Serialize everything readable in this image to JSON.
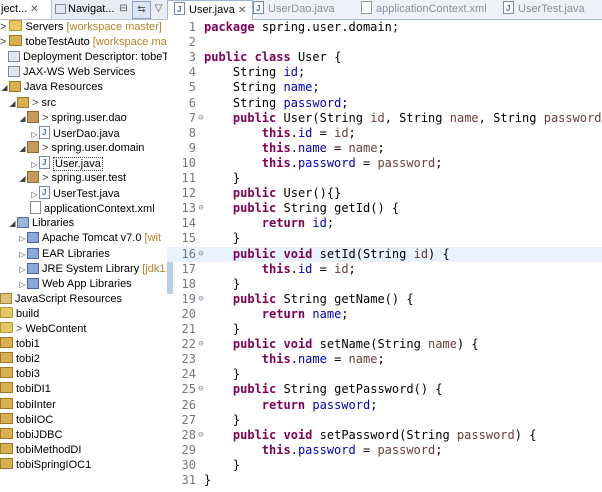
{
  "left_panel": {
    "tab1": {
      "label": "ject..."
    },
    "tab2": {
      "label": "Navigat..."
    },
    "tree": [
      {
        "text": "Servers",
        "hint": "[workspace master]",
        "prefix": ">",
        "icon": "folder"
      },
      {
        "text": "tobeTestAuto",
        "hint": "[workspace master",
        "prefix": ">",
        "icon": "project"
      },
      {
        "text": "Deployment Descriptor: tobeTes",
        "icon": "descriptor"
      },
      {
        "text": "JAX-WS Web Services",
        "icon": "webservices"
      },
      {
        "text": "Java Resources",
        "icon": "jres"
      },
      {
        "text": "src",
        "prefix": ">",
        "icon": "src"
      },
      {
        "text": "spring.user.dao",
        "prefix": ">",
        "icon": "package"
      },
      {
        "text": "UserDao.java",
        "icon": "java"
      },
      {
        "text": "spring.user.domain",
        "prefix": ">",
        "icon": "package"
      },
      {
        "text": "User.java",
        "icon": "java"
      },
      {
        "text": "spring.user.test",
        "prefix": ">",
        "icon": "package"
      },
      {
        "text": "UserTest.java",
        "icon": "java"
      },
      {
        "text": "applicationContext.xml",
        "icon": "xml"
      },
      {
        "text": "Libraries",
        "icon": "libraries"
      },
      {
        "text": "Apache Tomcat v7.0",
        "hint": "[wit",
        "icon": "jar"
      },
      {
        "text": "EAR Libraries",
        "icon": "jar"
      },
      {
        "text": "JRE System Library",
        "hint": "[jdk1.",
        "icon": "jar"
      },
      {
        "text": "Web App Libraries",
        "icon": "jar"
      },
      {
        "text": "JavaScript Resources",
        "icon": "js"
      },
      {
        "text": "build",
        "icon": "folder"
      },
      {
        "text": "WebContent",
        "prefix": ">",
        "icon": "folder"
      },
      {
        "text": "tobi1",
        "icon": "project"
      },
      {
        "text": "tobi2",
        "icon": "project"
      },
      {
        "text": "tobi3",
        "icon": "project"
      },
      {
        "text": "tobiDI1",
        "icon": "project"
      },
      {
        "text": "tobiInter",
        "icon": "project"
      },
      {
        "text": "tobiIOC",
        "icon": "project"
      },
      {
        "text": "tobiJDBC",
        "icon": "project"
      },
      {
        "text": "tobiMethodDI",
        "icon": "project"
      },
      {
        "text": "tobiSpringIOC1",
        "icon": "project"
      }
    ]
  },
  "editor": {
    "tabs": [
      {
        "label": "User.java",
        "active": true,
        "icon": "java"
      },
      {
        "label": "UserDao.java",
        "active": false,
        "icon": "java"
      },
      {
        "label": "applicationContext.xml",
        "active": false,
        "icon": "xml"
      },
      {
        "label": "UserTest.java",
        "active": false,
        "icon": "java"
      }
    ],
    "line_numbers": [
      "1",
      "2",
      "3",
      "4",
      "5",
      "6",
      "7",
      "8",
      "9",
      "10",
      "11",
      "12",
      "13",
      "14",
      "15",
      "16",
      "17",
      "18",
      "19",
      "20",
      "21",
      "22",
      "23",
      "24",
      "25",
      "26",
      "27",
      "28",
      "29",
      "30",
      "31"
    ],
    "code": [
      "package spring.user.domain;",
      "",
      "public class User {",
      "    String id;",
      "    String name;",
      "    String password;",
      "    public User(String id, String name, String password) {",
      "        this.id = id;",
      "        this.name = name;",
      "        this.password = password;",
      "    }",
      "    public User(){}",
      "    public String getId() {",
      "        return id;",
      "    }",
      "    public void setId(String id) {",
      "        this.id = id;",
      "    }",
      "    public String getName() {",
      "        return name;",
      "    }",
      "    public void setName(String name) {",
      "        this.name = name;",
      "    }",
      "    public String getPassword() {",
      "        return password;",
      "    }",
      "    public void setPassword(String password) {",
      "        this.password = password;",
      "    }",
      "}"
    ],
    "highlighted_line": "16",
    "colors": {
      "keyword": "#7f0055",
      "field": "#0000c0",
      "param": "#6a3e3e",
      "highlight": "#e8f2fe"
    }
  }
}
